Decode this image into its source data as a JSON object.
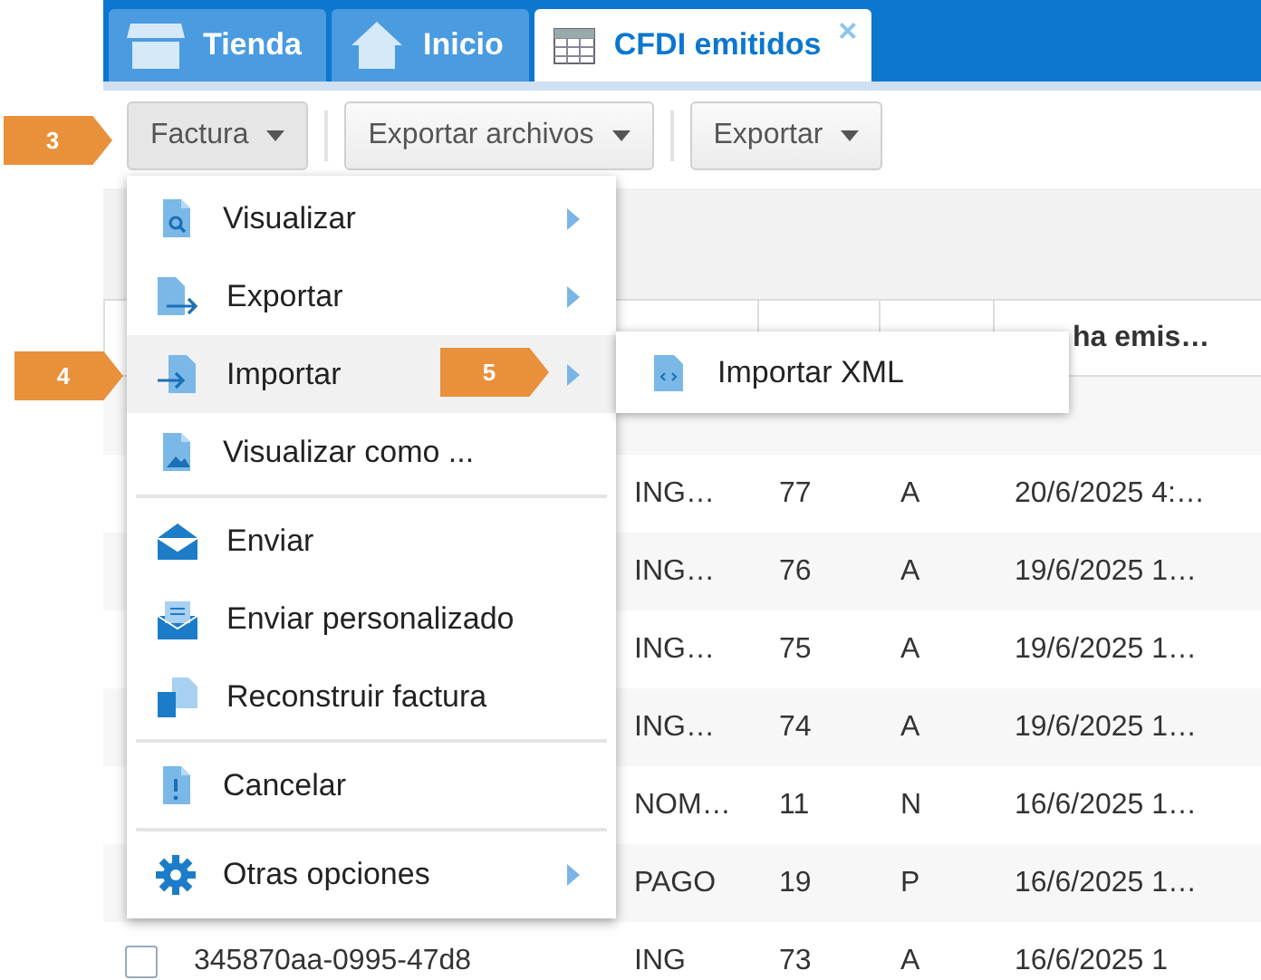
{
  "tabs": [
    {
      "label": "Tienda",
      "selected": false
    },
    {
      "label": "Inicio",
      "selected": false
    },
    {
      "label": "CFDI emitidos",
      "selected": true,
      "close": "×"
    }
  ],
  "toolbar": [
    {
      "label": "Factura",
      "open": true
    },
    {
      "label": "Exportar archivos",
      "open": false
    },
    {
      "label": "Exportar",
      "open": false
    }
  ],
  "table": {
    "header": {
      "column_6": "ha emis…"
    },
    "rows": [
      {},
      {
        "tipo": "ING…",
        "folio": "77",
        "serie": "A",
        "fecha": "20/6/2025 4:…"
      },
      {
        "tipo": "ING…",
        "folio": "76",
        "serie": "A",
        "fecha": "19/6/2025 1…"
      },
      {
        "tipo": "ING…",
        "folio": "75",
        "serie": "A",
        "fecha": "19/6/2025 1…"
      },
      {
        "tipo": "ING…",
        "folio": "74",
        "serie": "A",
        "fecha": "19/6/2025 1…"
      },
      {
        "tipo": "NOM…",
        "folio": "11",
        "serie": "N",
        "fecha": "16/6/2025 1…"
      },
      {
        "tipo": "PAGO",
        "folio": "19",
        "serie": "P",
        "fecha": "16/6/2025 1…"
      },
      {
        "checked": false,
        "id": "345870aa-0995-47d8",
        "tipo": "ING",
        "folio": "73",
        "serie": "A",
        "fecha": "16/6/2025 1"
      }
    ]
  },
  "menu": {
    "items": [
      {
        "label": "Visualizar",
        "selected": false,
        "submenu": true,
        "separator_before": false
      },
      {
        "label": "Exportar",
        "selected": false,
        "submenu": true,
        "separator_before": false
      },
      {
        "label": "Importar",
        "selected": true,
        "submenu": true,
        "separator_before": false
      },
      {
        "label": "Visualizar como ...",
        "selected": false,
        "submenu": false,
        "separator_before": false
      },
      {
        "label": "Enviar",
        "selected": false,
        "submenu": false,
        "separator_before": true
      },
      {
        "label": "Enviar personalizado",
        "selected": false,
        "submenu": false,
        "separator_before": false
      },
      {
        "label": "Reconstruir factura",
        "selected": false,
        "submenu": false,
        "separator_before": false
      },
      {
        "label": "Cancelar",
        "selected": false,
        "submenu": false,
        "separator_before": true
      },
      {
        "label": "Otras opciones",
        "selected": false,
        "submenu": true,
        "separator_before": true
      }
    ]
  },
  "submenu": {
    "items": [
      {
        "label": "Importar XML",
        "selected": false
      }
    ]
  },
  "callouts": [
    {
      "label": "3"
    },
    {
      "label": "4"
    },
    {
      "label": "5"
    }
  ]
}
